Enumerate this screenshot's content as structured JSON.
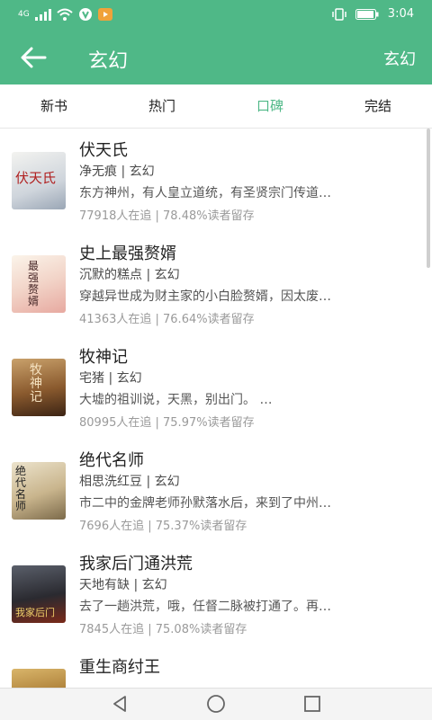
{
  "status": {
    "signal": "4G",
    "time": "3:04"
  },
  "header": {
    "title": "玄幻",
    "action": "玄幻"
  },
  "tabs": [
    "新书",
    "热门",
    "口碑",
    "完结"
  ],
  "books": [
    {
      "title": "伏天氏",
      "author": "净无痕",
      "genre": "玄幻",
      "desc": "东方神州，有人皇立道统，有圣贤宗门传道…",
      "followers": "77918人在追",
      "retention": "78.48%读者留存",
      "cover_text": "伏天氏"
    },
    {
      "title": "史上最强赘婿",
      "author": "沉默的糕点",
      "genre": "玄幻",
      "desc": "穿越异世成为财主家的小白脸赘婿，因太废…",
      "followers": "41363人在追",
      "retention": "76.64%读者留存",
      "cover_text": "最强赘婿"
    },
    {
      "title": "牧神记",
      "author": "宅猪",
      "genre": "玄幻",
      "desc": "大墟的祖训说，天黑，别出门。 …",
      "followers": "80995人在追",
      "retention": "75.97%读者留存",
      "cover_text": "牧神记"
    },
    {
      "title": "绝代名师",
      "author": "相思洗红豆",
      "genre": "玄幻",
      "desc": "市二中的金牌老师孙默落水后，来到了中州…",
      "followers": "7696人在追",
      "retention": "75.37%读者留存",
      "cover_text": "绝代名师"
    },
    {
      "title": "我家后门通洪荒",
      "author": "天地有缺",
      "genre": "玄幻",
      "desc": "去了一趟洪荒，哦，任督二脉被打通了。再…",
      "followers": "7845人在追",
      "retention": "75.08%读者留存",
      "cover_text": "我家后门"
    },
    {
      "title": "重生商纣王",
      "author": "",
      "genre": "",
      "desc": "",
      "followers": "",
      "retention": "",
      "cover_text": ""
    }
  ]
}
